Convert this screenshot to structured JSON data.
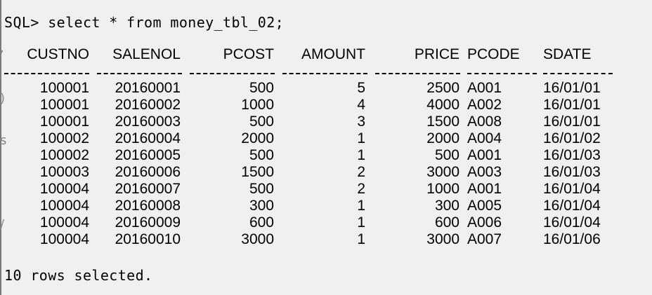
{
  "prompt": {
    "text": "SQL> select * from money_tbl_02;"
  },
  "table": {
    "columns": [
      "CUSTNO",
      "SALENOL",
      "PCOST",
      "AMOUNT",
      "PRICE",
      "PCODE",
      "SDATE"
    ],
    "rows": [
      [
        "100001",
        "20160001",
        "500",
        "5",
        "2500",
        "A001",
        "16/01/01"
      ],
      [
        "100001",
        "20160002",
        "1000",
        "4",
        "4000",
        "A002",
        "16/01/01"
      ],
      [
        "100001",
        "20160003",
        "500",
        "3",
        "1500",
        "A008",
        "16/01/01"
      ],
      [
        "100002",
        "20160004",
        "2000",
        "1",
        "2000",
        "A004",
        "16/01/02"
      ],
      [
        "100002",
        "20160005",
        "500",
        "1",
        "500",
        "A001",
        "16/01/03"
      ],
      [
        "100003",
        "20160006",
        "1500",
        "2",
        "3000",
        "A003",
        "16/01/03"
      ],
      [
        "100004",
        "20160007",
        "500",
        "2",
        "1000",
        "A001",
        "16/01/04"
      ],
      [
        "100004",
        "20160008",
        "300",
        "1",
        "300",
        "A005",
        "16/01/04"
      ],
      [
        "100004",
        "20160009",
        "600",
        "1",
        "600",
        "A006",
        "16/01/04"
      ],
      [
        "100004",
        "20160010",
        "3000",
        "1",
        "3000",
        "A007",
        "16/01/06"
      ]
    ]
  },
  "footer": {
    "text": "10 rows selected."
  }
}
